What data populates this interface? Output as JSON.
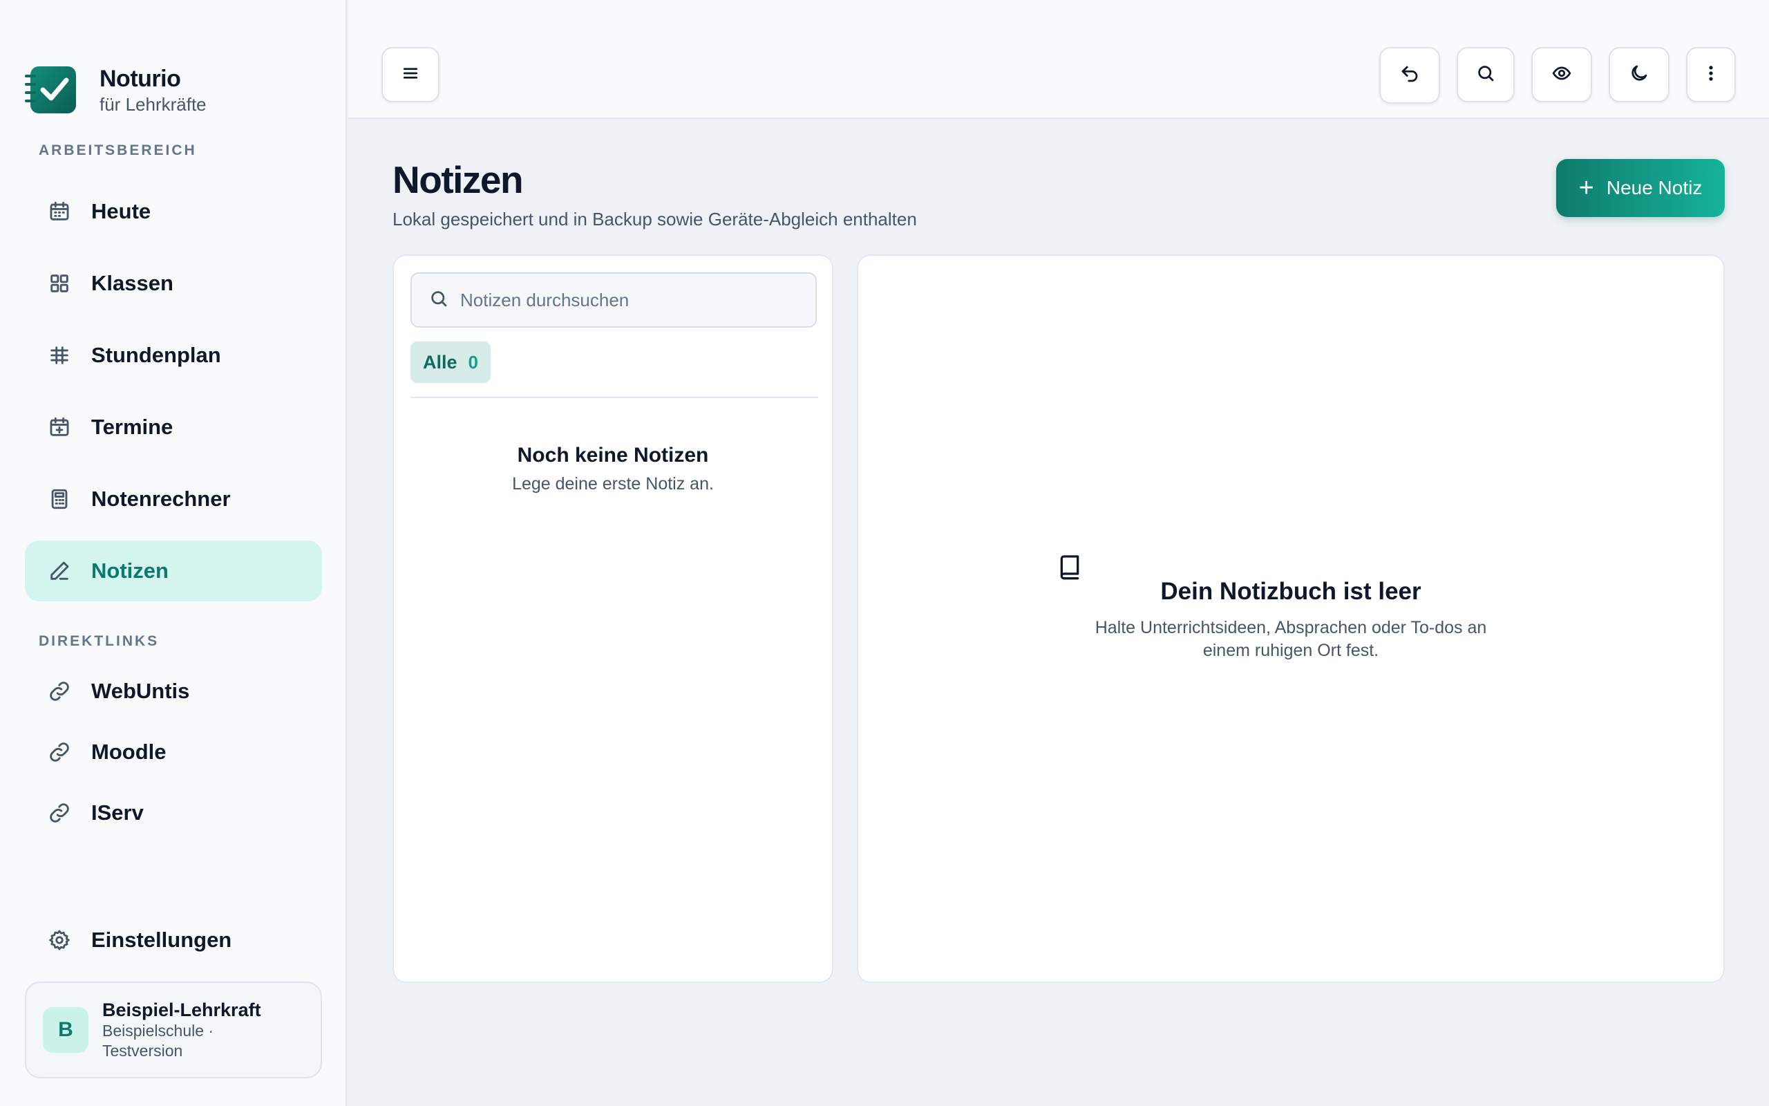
{
  "brand": {
    "name": "Noturio",
    "subtitle": "für Lehrkräfte"
  },
  "sidebar": {
    "section_workspace": "ARBEITSBEREICH",
    "workspace_items": [
      {
        "label": "Heute",
        "icon": "calendar-icon"
      },
      {
        "label": "Klassen",
        "icon": "grid-icon"
      },
      {
        "label": "Stundenplan",
        "icon": "table-icon"
      },
      {
        "label": "Termine",
        "icon": "calendar-plus-icon"
      },
      {
        "label": "Notenrechner",
        "icon": "calculator-icon"
      },
      {
        "label": "Notizen",
        "icon": "pencil-icon",
        "active": true
      }
    ],
    "section_links": "DIREKTLINKS",
    "link_items": [
      {
        "label": "WebUntis",
        "icon": "link-icon"
      },
      {
        "label": "Moodle",
        "icon": "link-icon"
      },
      {
        "label": "IServ",
        "icon": "link-icon"
      }
    ],
    "settings_label": "Einstellungen",
    "profile": {
      "initial": "B",
      "name": "Beispiel-Lehrkraft",
      "meta_line1": "Beispielschule ·",
      "meta_line2": "Testversion"
    }
  },
  "topbar": {
    "buttons": [
      "menu-icon",
      "undo-icon",
      "search-icon",
      "eye-icon",
      "moon-icon",
      "more-vertical-icon"
    ]
  },
  "main": {
    "title": "Notizen",
    "subtitle": "Lokal gespeichert und in Backup sowie Geräte-Abgleich enthalten",
    "new_button": "Neue Notiz",
    "search_placeholder": "Notizen durchsuchen",
    "filter": {
      "label": "Alle",
      "count": "0"
    },
    "empty_list": {
      "title": "Noch keine Notizen",
      "subtitle": "Lege deine erste Notiz an."
    },
    "empty_detail": {
      "title": "Dein Notizbuch ist leer",
      "subtitle": "Halte Unterrichtsideen, Absprachen oder To-dos an einem ruhigen Ort fest."
    }
  },
  "colors": {
    "accent": "#0f7a6c",
    "accent_light": "#d3f4ef",
    "text": "#0f172a",
    "muted": "#475569"
  }
}
